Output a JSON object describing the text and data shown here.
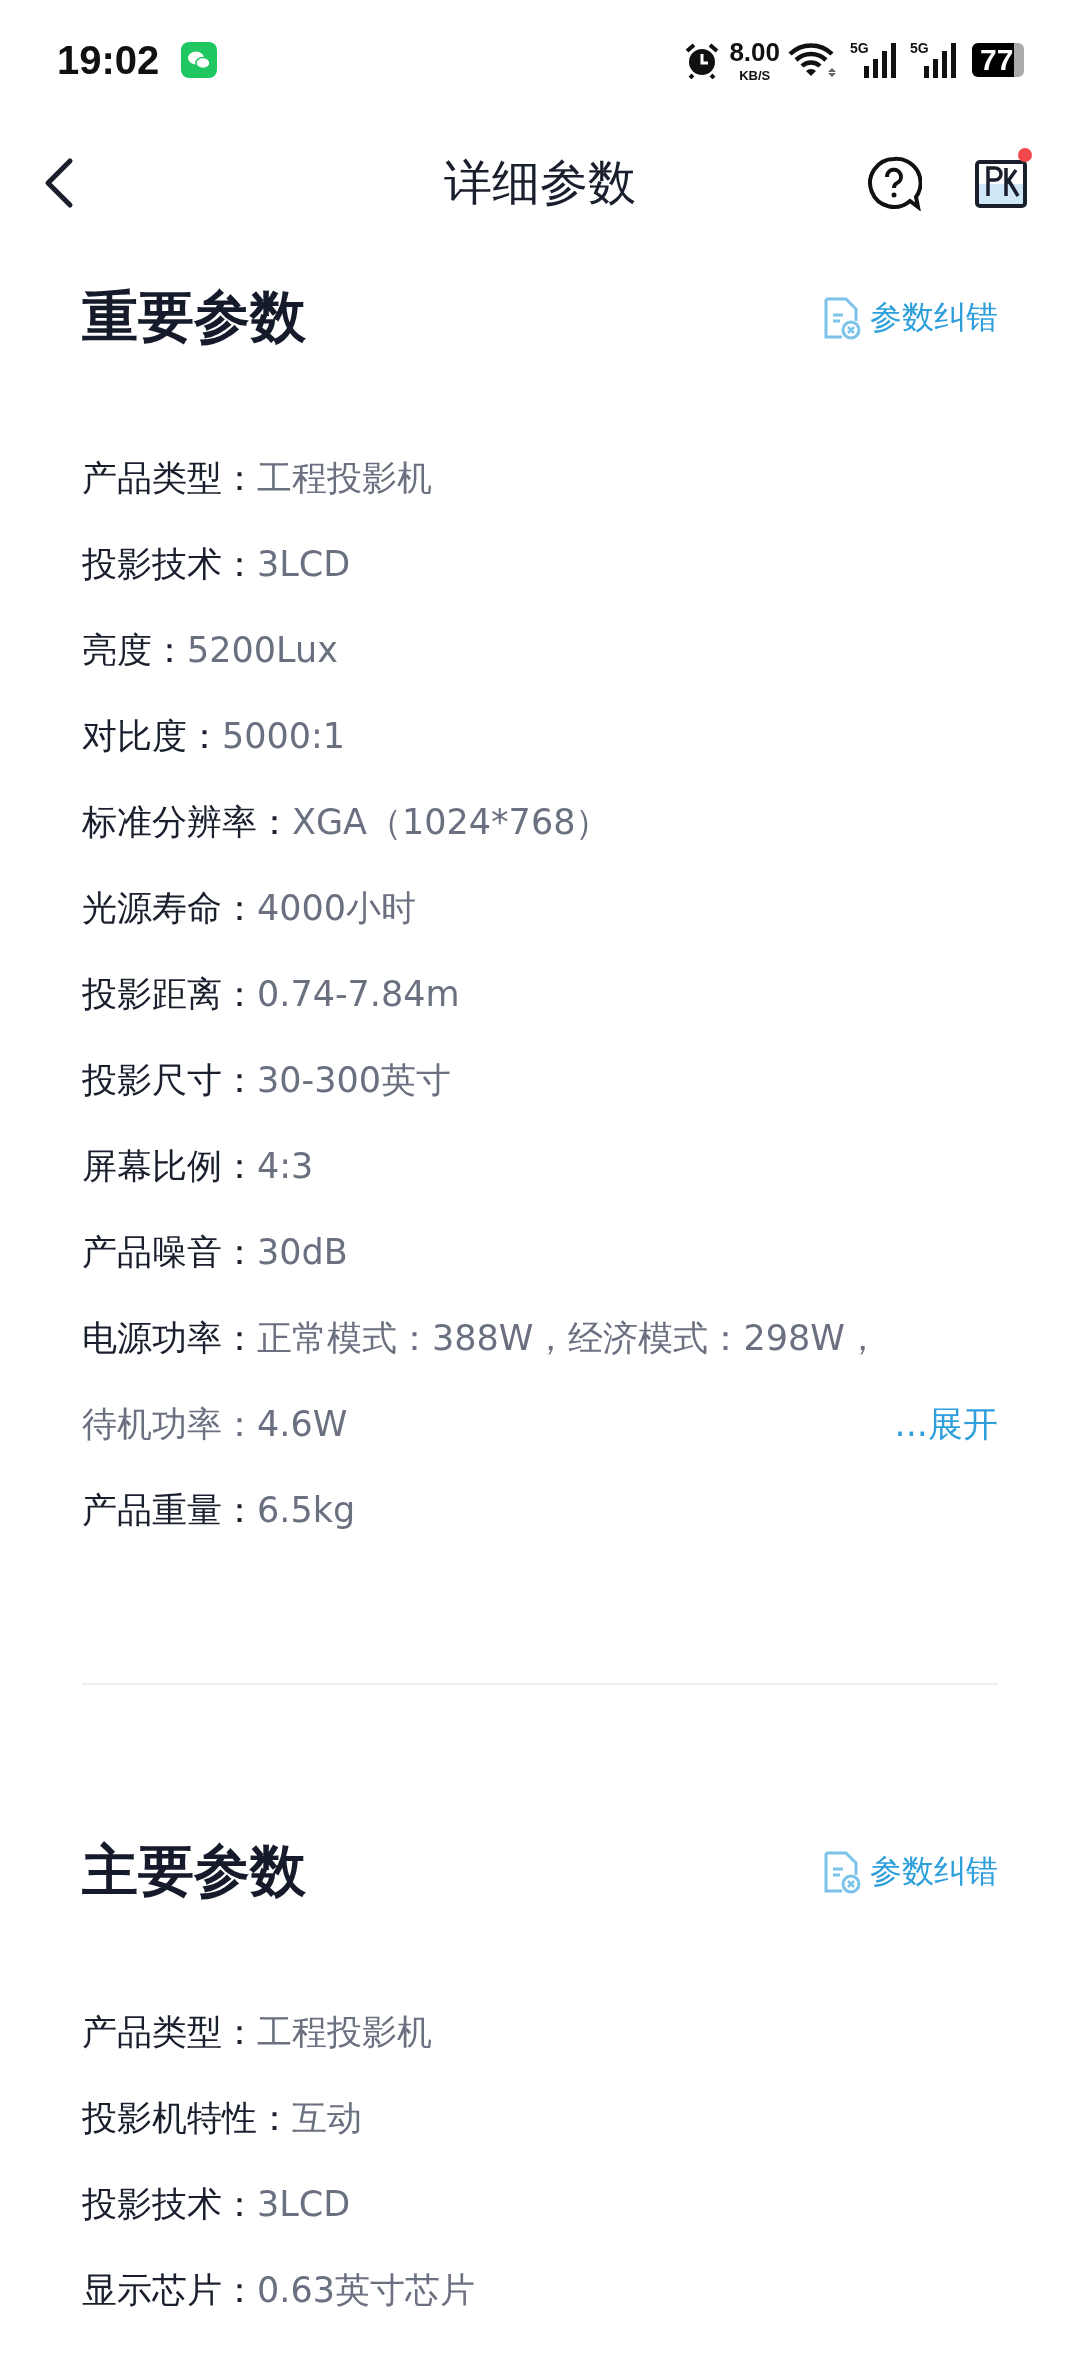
{
  "status_bar": {
    "time": "19:02",
    "net_speed": "8.00",
    "net_unit": "KB/S",
    "sim_labels": [
      "5G",
      "5G"
    ],
    "battery": "77"
  },
  "nav": {
    "title": "详细参数",
    "pk_badge": true
  },
  "sections": [
    {
      "title": "重要参数",
      "action": "参数纠错",
      "params": [
        {
          "label": "产品类型：",
          "value": "工程投影机"
        },
        {
          "label": "投影技术：",
          "value": "3LCD"
        },
        {
          "label": "亮度：",
          "value": "5200Lux"
        },
        {
          "label": "对比度：",
          "value": "5000:1"
        },
        {
          "label": "标准分辨率：",
          "value": "XGA（1024*768）"
        },
        {
          "label": "光源寿命：",
          "value": "4000小时"
        },
        {
          "label": "投影距离：",
          "value": "0.74-7.84m"
        },
        {
          "label": "投影尺寸：",
          "value": "30-300英寸"
        },
        {
          "label": "屏幕比例：",
          "value": "4:3"
        },
        {
          "label": "产品噪音：",
          "value": "30dB"
        },
        {
          "label": "电源功率：",
          "value": "正常模式：388W，经济模式：298W，",
          "continuation": "待机功率：4.6W",
          "expand": "...展开"
        },
        {
          "label": "产品重量：",
          "value": "6.5kg"
        }
      ]
    },
    {
      "title": "主要参数",
      "action": "参数纠错",
      "params": [
        {
          "label": "产品类型：",
          "value": "工程投影机"
        },
        {
          "label": "投影机特性：",
          "value": "互动"
        },
        {
          "label": "投影技术：",
          "value": "3LCD"
        },
        {
          "label": "显示芯片：",
          "value": "0.63英寸芯片"
        }
      ]
    }
  ]
}
